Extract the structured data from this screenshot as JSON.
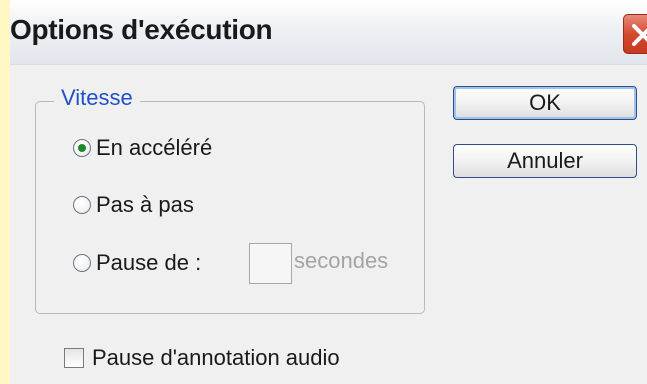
{
  "dialog": {
    "title": "Options d'exécution",
    "close_icon": "close-icon"
  },
  "speed_group": {
    "legend": "Vitesse",
    "options": [
      {
        "label": "En accéléré",
        "checked": true
      },
      {
        "label": "Pas à pas",
        "checked": false
      },
      {
        "label": "Pause de :",
        "checked": false
      }
    ],
    "seconds_value": "",
    "seconds_unit": "secondes"
  },
  "buttons": {
    "ok_label": "OK",
    "cancel_label": "Annuler"
  },
  "audio_pause": {
    "label": "Pause d'annotation audio",
    "checked": false
  },
  "colors": {
    "legend": "#2050c8",
    "close_button": "#d44a30",
    "radio_dot": "#1b8a2a"
  }
}
